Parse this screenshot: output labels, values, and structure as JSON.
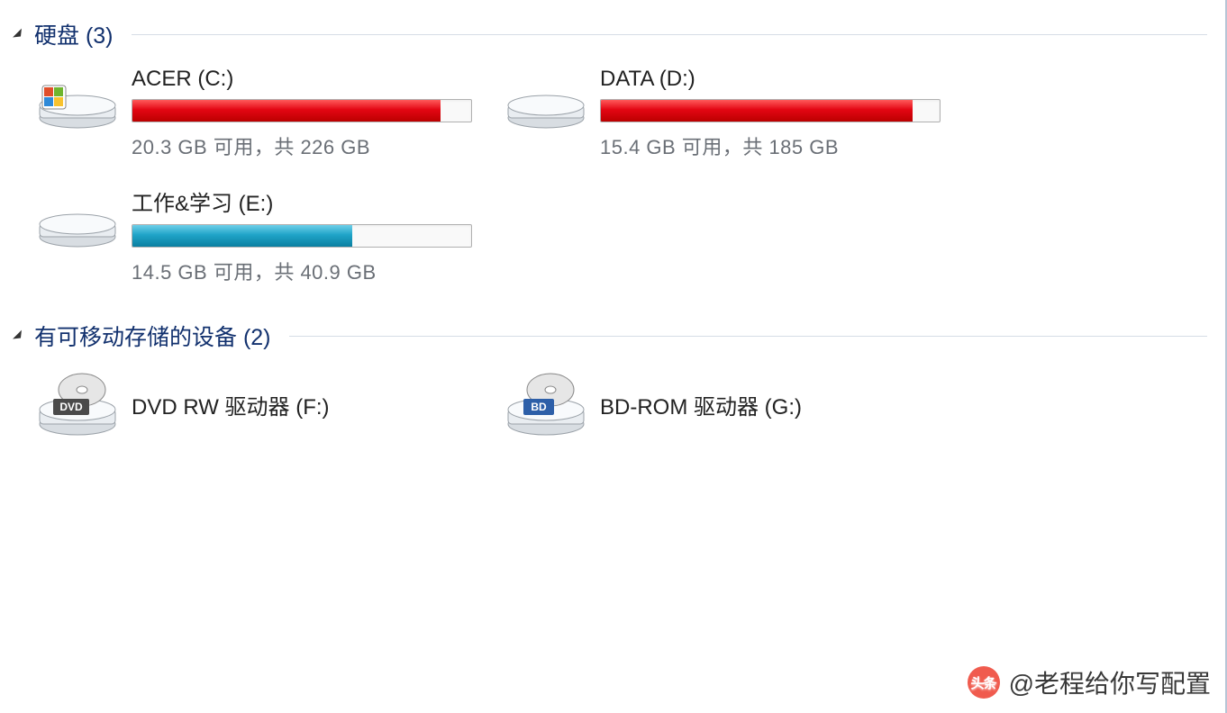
{
  "groups": {
    "hardDisk": {
      "title": "硬盘 (3)",
      "drives": [
        {
          "label": "ACER (C:)",
          "status": "20.3 GB 可用，共 226 GB",
          "fillPercent": 91,
          "fillColor": "red",
          "iconType": "system"
        },
        {
          "label": "DATA (D:)",
          "status": "15.4 GB 可用，共 185 GB",
          "fillPercent": 92,
          "fillColor": "red",
          "iconType": "hdd"
        },
        {
          "label": "工作&学习 (E:)",
          "status": "14.5 GB 可用，共 40.9 GB",
          "fillPercent": 65,
          "fillColor": "blue",
          "iconType": "hdd"
        }
      ]
    },
    "removable": {
      "title": "有可移动存储的设备 (2)",
      "drives": [
        {
          "label": "DVD RW 驱动器 (F:)",
          "iconType": "dvd",
          "badge": "DVD"
        },
        {
          "label": "BD-ROM 驱动器 (G:)",
          "iconType": "bd",
          "badge": "BD"
        }
      ]
    }
  },
  "watermark": {
    "logoText": "头条",
    "text": "@老程给你写配置"
  }
}
